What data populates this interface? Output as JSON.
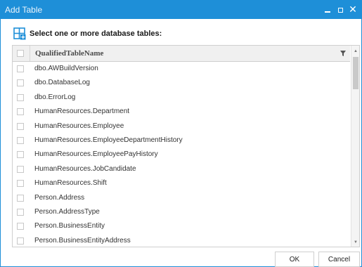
{
  "window": {
    "title": "Add Table",
    "titlebar_color": "#1e8fd8",
    "controls": {
      "minimize_glyph": "_",
      "maximize_icon": "maximize-icon",
      "close_glyph": "✕"
    }
  },
  "prompt": {
    "icon": "add-table-icon",
    "text": "Select one or more database tables:"
  },
  "grid": {
    "column_header": "QualifiedTableName",
    "filter_icon": "filter-icon",
    "rows": [
      "dbo.AWBuildVersion",
      "dbo.DatabaseLog",
      "dbo.ErrorLog",
      "HumanResources.Department",
      "HumanResources.Employee",
      "HumanResources.EmployeeDepartmentHistory",
      "HumanResources.EmployeePayHistory",
      "HumanResources.JobCandidate",
      "HumanResources.Shift",
      "Person.Address",
      "Person.AddressType",
      "Person.BusinessEntity",
      "Person.BusinessEntityAddress"
    ]
  },
  "buttons": {
    "ok": "OK",
    "cancel": "Cancel"
  }
}
